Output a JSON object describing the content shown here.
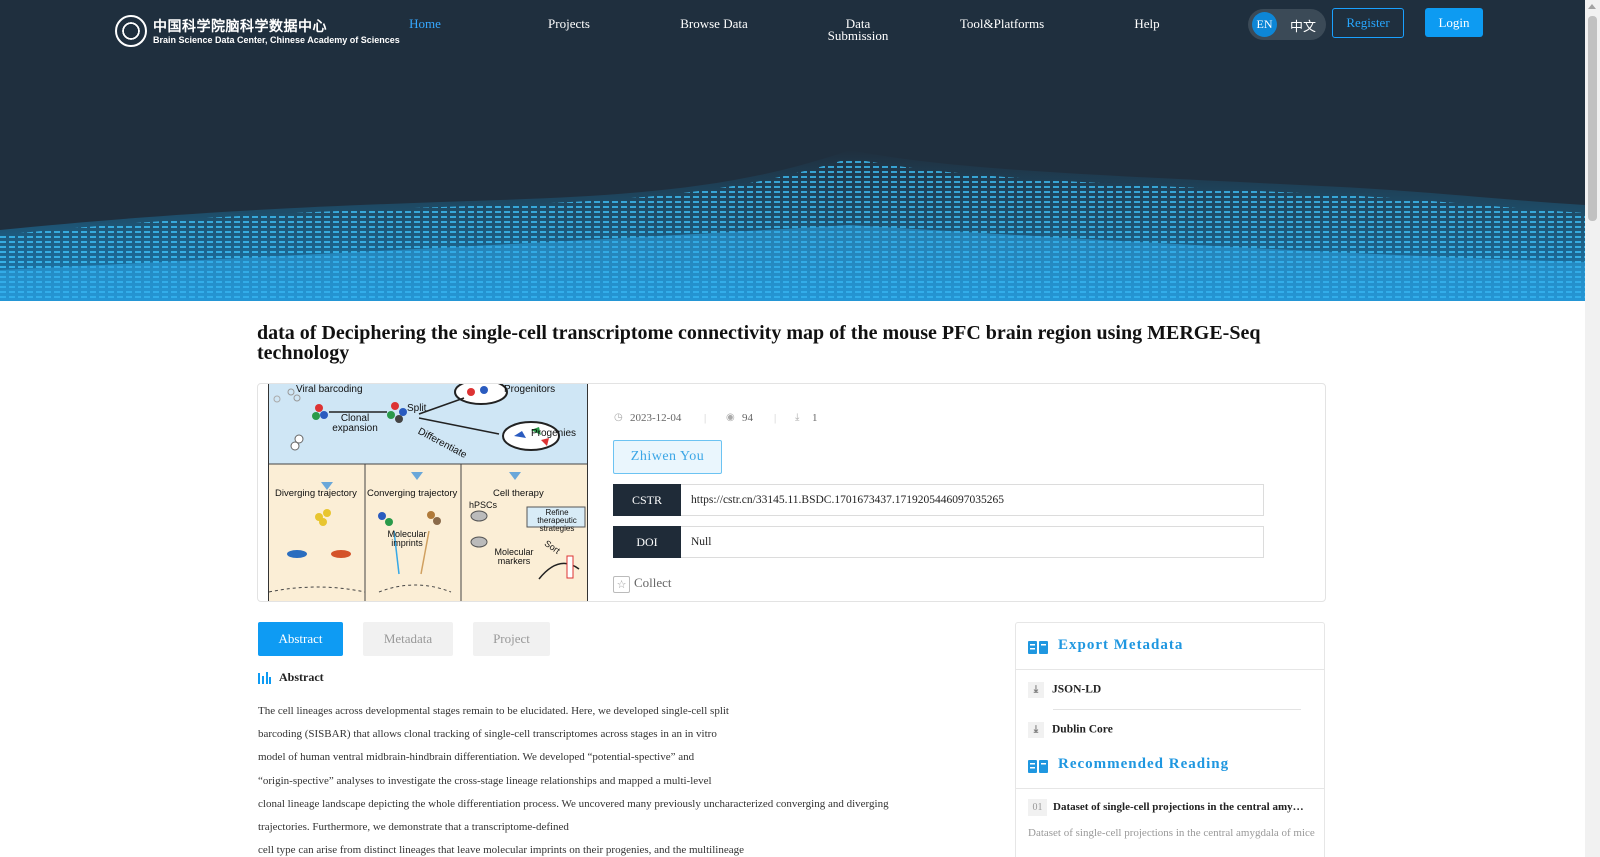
{
  "nav": {
    "logo_cn": "中国科学院脑科学数据中心",
    "logo_en": "Brain Science Data Center, Chinese Academy of Sciences",
    "items": [
      {
        "label": "Home"
      },
      {
        "label": "Projects"
      },
      {
        "label": "Browse Data"
      },
      {
        "label": "Data Submission"
      },
      {
        "label": "Tool&Platforms"
      },
      {
        "label": "Help"
      }
    ],
    "lang_en": "EN",
    "lang_zh": "中文",
    "register": "Register",
    "login": "Login"
  },
  "dataset": {
    "title": "data of Deciphering the single-cell transcriptome connectivity map of the mouse PFC brain region using MERGE-Seq technology",
    "date": "2023-12-04",
    "views": "94",
    "downloads": "1",
    "author": "Zhiwen You",
    "cstr_label": "CSTR",
    "cstr_value": "https://cstr.cn/33145.11.BSDC.1701673437.1719205446097035265",
    "doi_label": "DOI",
    "doi_value": "Null",
    "collect": "Collect"
  },
  "figure": {
    "labels": {
      "viral": "Viral barcoding",
      "clonal": "Clonal expansion",
      "split": "Split",
      "differentiate": "Differentiate",
      "progenitors": "Progenitors",
      "progenies": "Progenies",
      "diverging": "Diverging trajectory",
      "converging": "Converging trajectory",
      "therapy": "Cell therapy",
      "hpscs": "hPSCs",
      "refine": "Refine therapeutic strategies",
      "molecular_imprints": "Molecular imprints",
      "molecular_markers": "Molecular markers",
      "sort": "Sort"
    }
  },
  "tabs": [
    {
      "label": "Abstract",
      "active": true
    },
    {
      "label": "Metadata",
      "active": false
    },
    {
      "label": "Project",
      "active": false
    }
  ],
  "abstract": {
    "heading": "Abstract",
    "lines": [
      "The cell lineages across developmental stages remain to be elucidated. Here, we developed single-cell split",
      "barcoding (SISBAR) that allows clonal tracking of single-cell transcriptomes across stages in an in vitro",
      "model of human ventral midbrain-hindbrain differentiation. We developed “potential-spective” and",
      "“origin-spective” analyses to investigate the cross-stage lineage relationships and mapped a multi-level",
      "clonal lineage landscape depicting the whole differentiation process. We uncovered many previously unchar­acterized converging and diverging",
      "trajectories. Furthermore, we demonstrate that a transcriptome-defined",
      "cell type can arise from distinct lineages that leave molecular imprints on their progenies, and the multilineage"
    ]
  },
  "side": {
    "export_title": "Export Metadata",
    "export_items": [
      "JSON-LD",
      "Dublin Core"
    ],
    "recommend_title": "Recommended Reading",
    "rec_items": [
      {
        "num": "01",
        "title": "Dataset of single-cell projections in the central amygdala of mice",
        "desc": "Dataset of single-cell projections in the central amygdala of mice"
      }
    ]
  },
  "colors": {
    "accent": "#0e9bf3",
    "banner": "#1f2f3e",
    "nav_active": "#36a8ff"
  }
}
